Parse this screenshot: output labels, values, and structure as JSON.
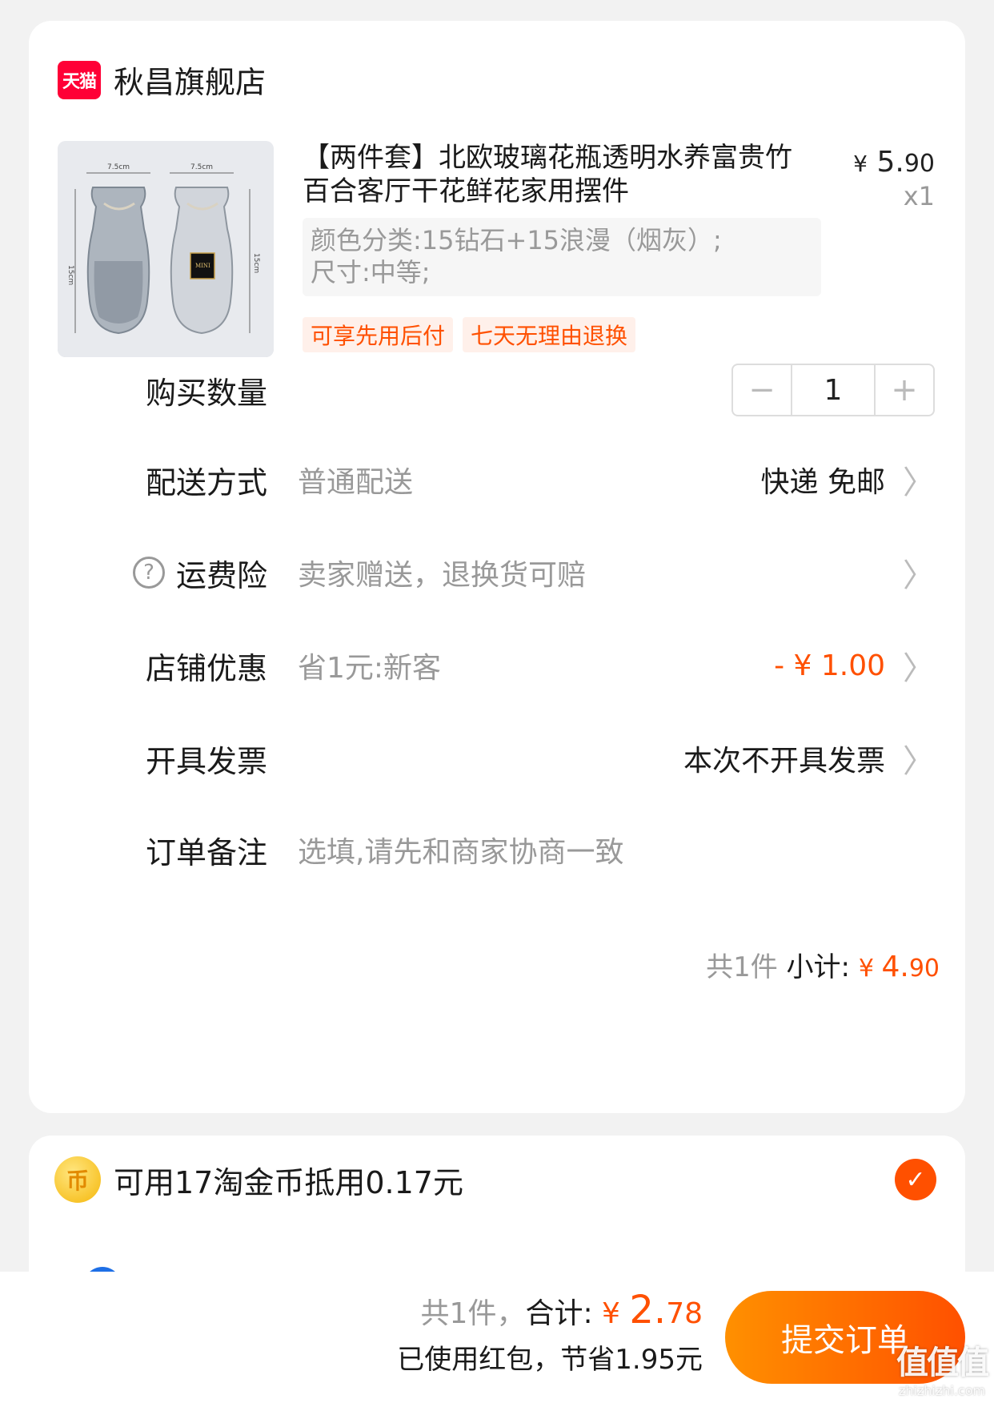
{
  "shop": {
    "badge": "天猫",
    "name": "秋昌旗舰店"
  },
  "product": {
    "title": "【两件套】北欧玻璃花瓶透明水养富贵竹百合客厅干花鲜花家用摆件",
    "price_currency": "¥",
    "price_int": "5.",
    "price_dec": "90",
    "quantity_label": "x1",
    "sku_lines": [
      "颜色分类:15钻石+15浪漫（烟灰）;",
      "尺寸:中等;"
    ],
    "tags": [
      "可享先用后付",
      "七天无理由退换"
    ],
    "image_text": {
      "width_left": "7.5cm",
      "width_right": "7.5cm",
      "height_left": "15cm",
      "height_right": "15cm",
      "label": "MINI"
    }
  },
  "rows": {
    "quantity": {
      "label": "购买数量",
      "minus": "−",
      "value": "1",
      "plus": "+"
    },
    "delivery": {
      "label": "配送方式",
      "sub": "普通配送",
      "value": "快递 免邮",
      "chevron": "〉"
    },
    "shipping_insurance": {
      "help": "?",
      "label": "运费险",
      "sub": "卖家赠送，退换货可赔",
      "chevron": "〉"
    },
    "store_discount": {
      "label": "店铺优惠",
      "sub": "省1元:新客",
      "value": "- ¥ 1.00",
      "chevron": "〉"
    },
    "invoice": {
      "label": "开具发票",
      "value": "本次不开具发票",
      "chevron": "〉"
    },
    "note": {
      "label": "订单备注",
      "placeholder": "选填,请先和商家协商一致"
    }
  },
  "subtotal": {
    "count": "共1件",
    "label": " 小计: ",
    "currency": "¥ ",
    "amount_int": "4.",
    "amount_dec": "90"
  },
  "coins": {
    "icon": "币",
    "text": "可用17淘金币抵用0.17元",
    "check": "✓"
  },
  "bottom": {
    "count": "共1件，",
    "label": "合计: ",
    "currency": "¥ ",
    "amount_int": "2.",
    "amount_dec": "78",
    "savings": "已使用红包，节省1.95元",
    "submit": "提交订单"
  },
  "watermark": {
    "big": "值值值",
    "small": "zhizhizhi.com"
  },
  "colors": {
    "accent": "#ff5000",
    "tmall_red": "#ff0036",
    "muted": "#999999"
  }
}
